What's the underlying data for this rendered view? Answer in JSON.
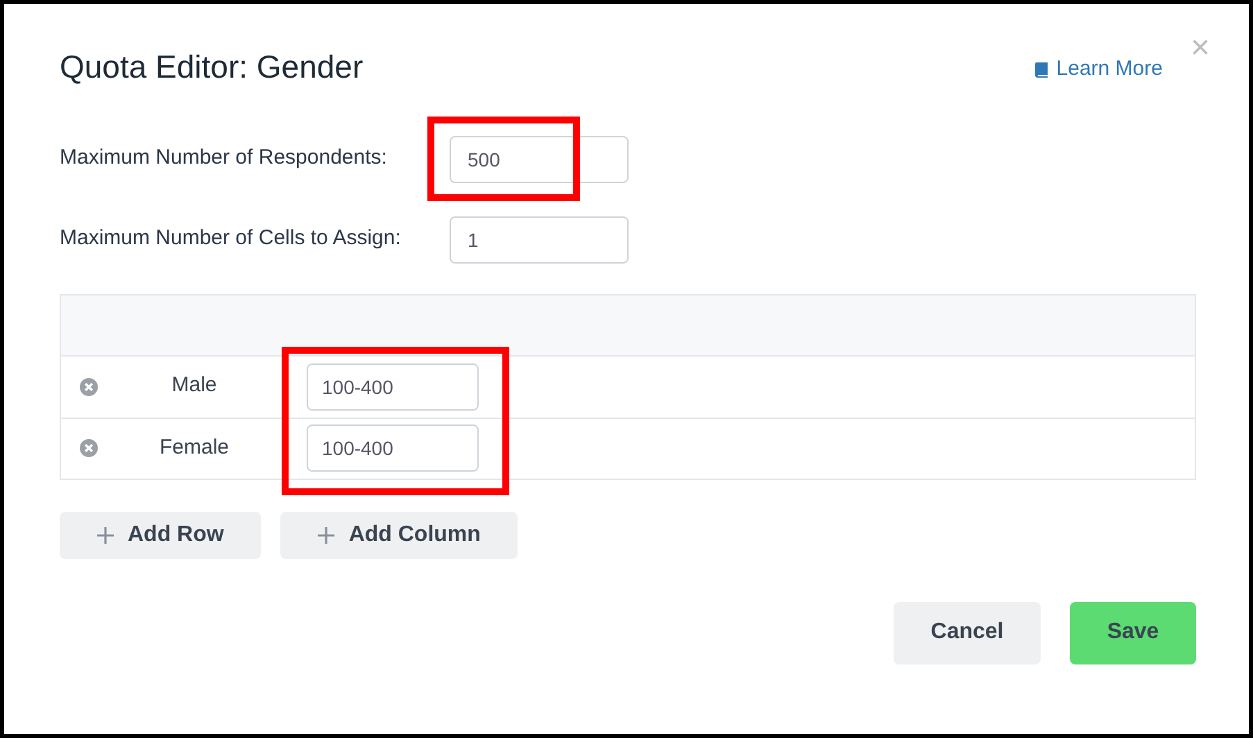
{
  "dialog": {
    "title": "Quota Editor: Gender",
    "learn_more": "Learn More",
    "close": "×"
  },
  "fields": [
    {
      "label": "Maximum Number of Respondents:",
      "value": "500",
      "highlighted": true
    },
    {
      "label": "Maximum Number of Cells to Assign:",
      "value": "1",
      "highlighted": false
    }
  ],
  "table": {
    "highlighted": true,
    "rows": [
      {
        "label": "Male",
        "value": "100-400"
      },
      {
        "label": "Female",
        "value": "100-400"
      }
    ]
  },
  "table_buttons": [
    "Add Row",
    "Add Column"
  ],
  "footer_buttons": [
    {
      "label": "Cancel",
      "kind": "secondary"
    },
    {
      "label": "Save",
      "kind": "primary"
    }
  ]
}
